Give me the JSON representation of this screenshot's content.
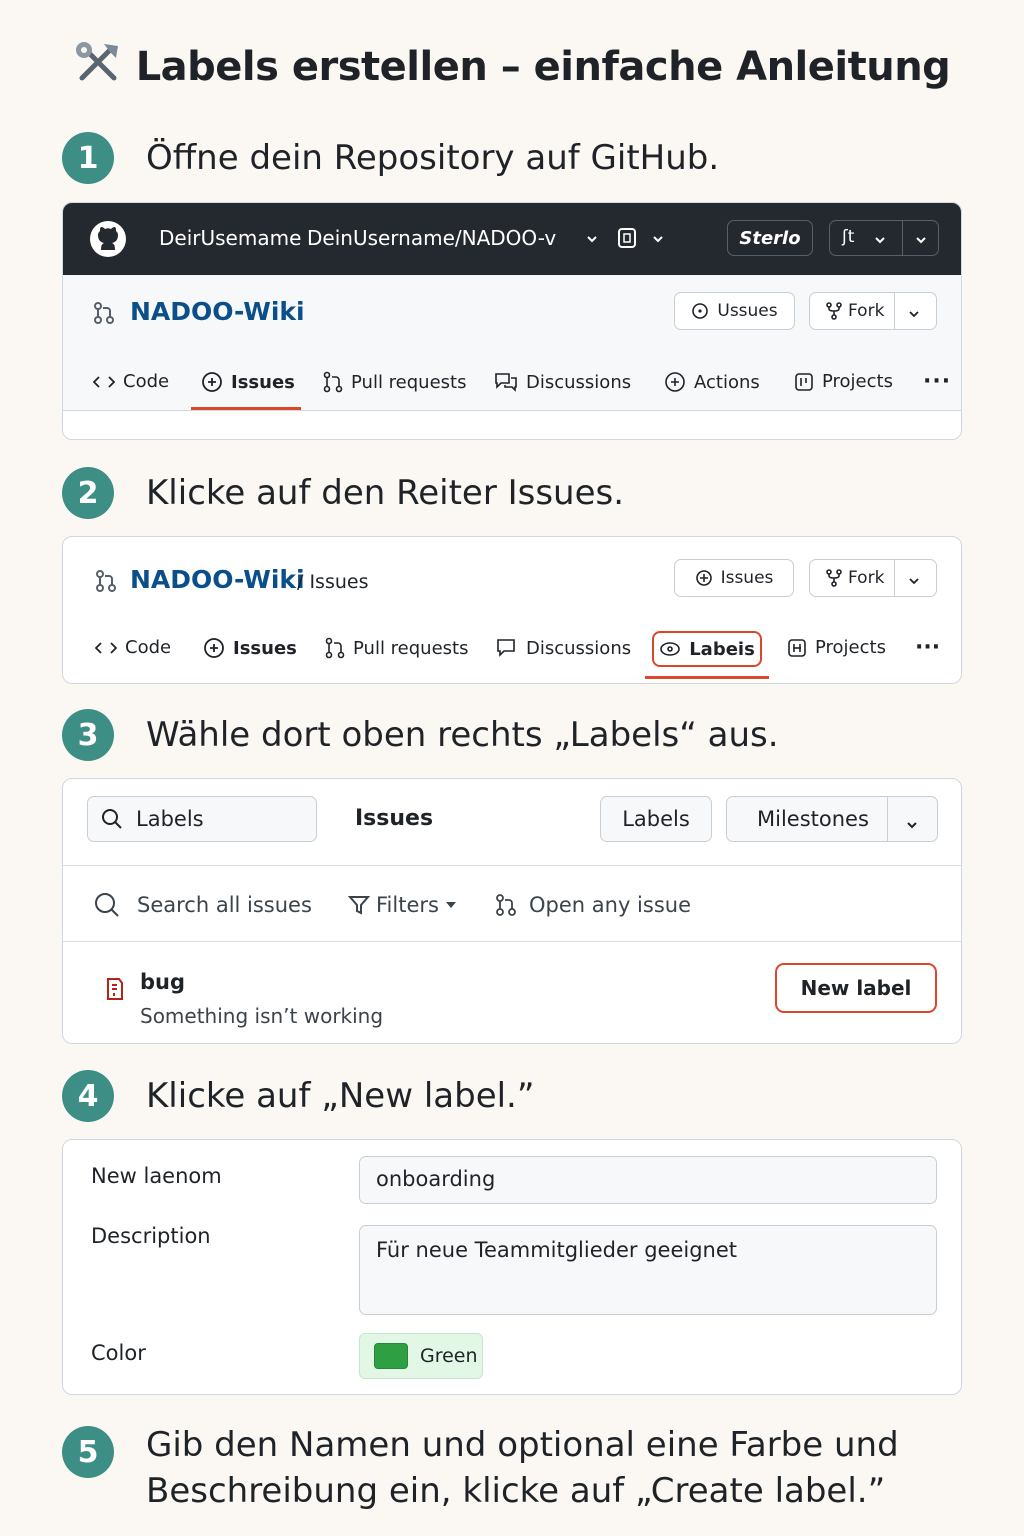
{
  "page_title": "Labels erstellen – einfache Anleitung",
  "steps": [
    {
      "num": "1",
      "text": "Öffne dein Repository auf GitHub."
    },
    {
      "num": "2",
      "text": "Klicke auf den Reiter Issues."
    },
    {
      "num": "3",
      "text": "Wähle dort oben rechts „Labels“ aus."
    },
    {
      "num": "4",
      "text": "Klicke auf „New label.”"
    },
    {
      "num": "5",
      "text_line1": "Gib den Namen und optional eine Farbe und",
      "text_line2": "Beschreibung ein, klicke auf „Create label.”"
    }
  ],
  "card1": {
    "header": {
      "username": "DeirUsemame",
      "repo_path": "DeinUsername/NADOO-v",
      "star_label": "Sterlo",
      "menu_glyph": "ʃt"
    },
    "repo_name": "NADOO-Wiki",
    "issues_button": "Ussues",
    "fork_button": "Fork",
    "tabs": [
      "Code",
      "Issues",
      "Pull requests",
      "Discussions",
      "Actions",
      "Projects"
    ]
  },
  "card2": {
    "repo_name": "NADOO-Wiki",
    "breadcrumb": "/ Issues",
    "issues_button": "Issues",
    "fork_button": "Fork",
    "tabs": [
      "Code",
      "Issues",
      "Pull requests",
      "Discussions",
      "Labeis",
      "Projects"
    ]
  },
  "card3": {
    "search_value": "Labels",
    "issues_heading": "Issues",
    "labels_button": "Labels",
    "milestones_button": "Milestones",
    "search_all": "Search all issues",
    "filters": "Filters",
    "open_any": "Open any issue",
    "label_name": "bug",
    "label_description": "Something isn’t working",
    "new_label_button": "New label"
  },
  "card4": {
    "name_label": "New laenom",
    "name_value": "onboarding",
    "description_label": "Description",
    "description_value": "Für neue Teammitglieder geeignet",
    "color_label": "Color",
    "color_value": "Green"
  },
  "colors": {
    "accent_step": "#3d8f85",
    "highlight": "#d9482b",
    "repo_link": "#0b4f8a",
    "swatch_green": "#2ea043",
    "header_dark": "#24292f"
  }
}
